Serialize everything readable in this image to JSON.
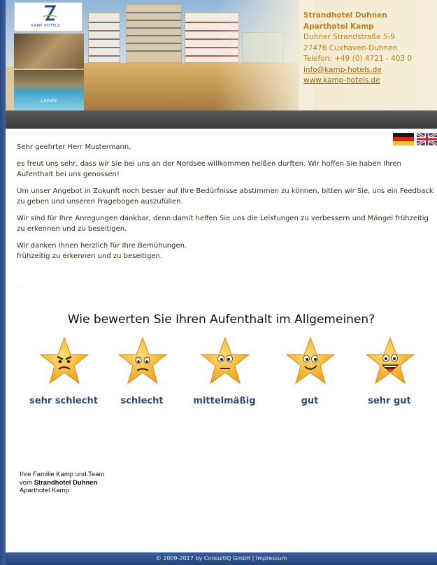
{
  "header": {
    "logo_text": "KAMP HOTELS",
    "pool_caption": "Lavida",
    "contact": {
      "name_line1": "Strandhotel Duhnen",
      "name_line2": "Aparthotel Kamp",
      "street": "Duhner Strandstraße 5-9",
      "city": "27476 Cuxhaven-Duhnen",
      "phone": "Telefon: +49 (0) 4721 - 403 0",
      "email": "info@kamp-hotels.de",
      "website": "www.kamp-hotels.de"
    }
  },
  "languages": [
    {
      "code": "de",
      "icon": "flag-germany-icon"
    },
    {
      "code": "en",
      "icon": "flag-uk-icon"
    }
  ],
  "letter": {
    "greeting": "Sehr geehrter Herr Mustermann,",
    "p1": "es freut uns sehr, dass wir Sie bei uns an der Nordsee willkommen heißen durften. Wir hoffen Sie haben Ihren Aufenthalt bei uns genossen!",
    "p2": "Um unser Angebot in Zukunft noch besser auf Ihre Bedürfnisse abstimmen zu können, bitten wir Sie, uns ein Feedback zu geben und unseren Fragebogen auszufüllen.",
    "p3": "Wir sind für Ihre Anregungen dankbar, denn damit helfen Sie uns die Leistungen zu verbessern und Mängel frühzeitig zu erkennen und zu beseitigen.",
    "p4_line1": "Wir danken Ihnen herzlich für Ihre Bemühungen.",
    "p4_line2": "frühzeitig zu erkennen und zu beseitigen.",
    "trailing": "."
  },
  "survey": {
    "question": "Wie bewerten Sie Ihren Aufenthalt im Allgemeinen?",
    "options": [
      {
        "label": "sehr schlecht",
        "icon": "angry-star-icon"
      },
      {
        "label": "schlecht",
        "icon": "sad-star-icon"
      },
      {
        "label": "mittelmäßig",
        "icon": "neutral-star-icon"
      },
      {
        "label": "gut",
        "icon": "smiling-star-icon"
      },
      {
        "label": "sehr gut",
        "icon": "laughing-star-icon"
      }
    ]
  },
  "signature": {
    "line1": "Ihre Familie Kamp und Team",
    "line2_prefix": "vom ",
    "line2_bold": "Strandhotel Duhnen",
    "line3": "Aparthotel Kamp"
  },
  "footer": {
    "copyright": "© 2009-2017 by ConsultiQ GmbH",
    "separator": " | ",
    "impressum": "Impressum"
  },
  "colors": {
    "frame": "#2f4f8a",
    "contact_text": "#b8861c",
    "rating_label": "#2d4a78",
    "star_fill": "#f5b51b"
  }
}
